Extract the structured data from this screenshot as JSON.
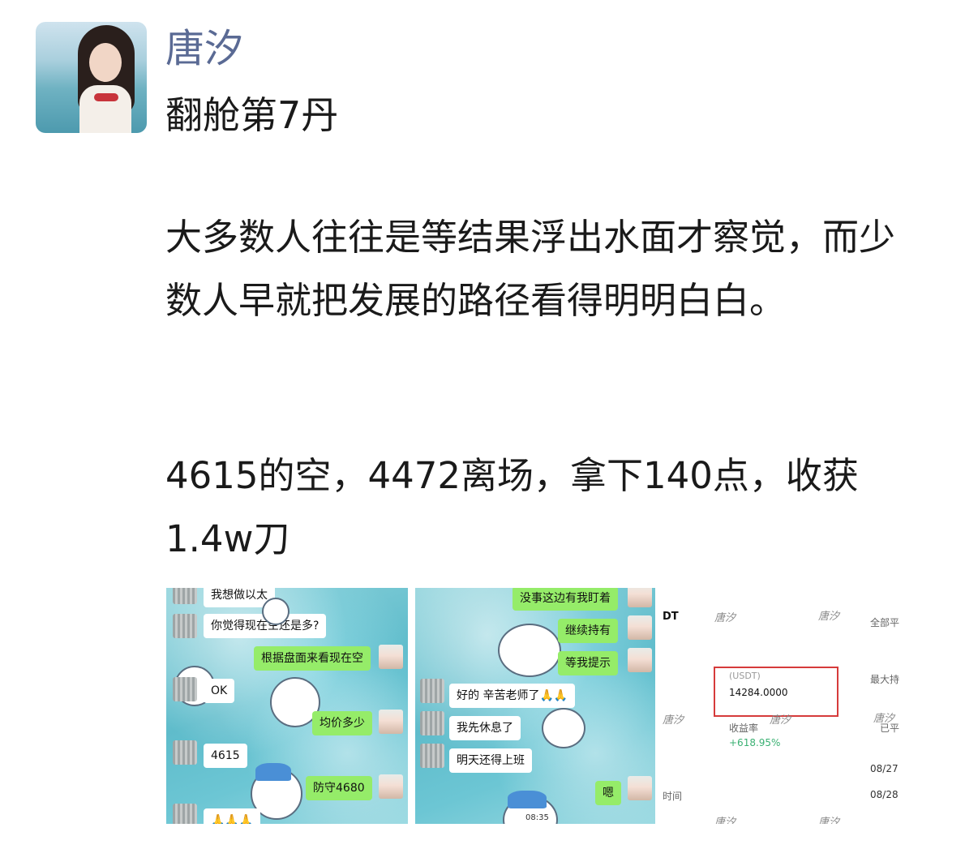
{
  "post": {
    "author": "唐汐",
    "title": "翻舱第7丹",
    "paragraph1": "大多数人往往是等结果浮出水面才察觉，而少数人早就把发展的路径看得明明白白。",
    "paragraph2": "4615的空，4472离场，拿下140点，收获1.4w刀"
  },
  "chat1": {
    "messages": [
      {
        "side": "left",
        "text": "我想做以太"
      },
      {
        "side": "left",
        "text": "你觉得现在空还是多?"
      },
      {
        "side": "right",
        "text": "根据盘面来看现在空"
      },
      {
        "side": "left",
        "text": "OK"
      },
      {
        "side": "right",
        "text": "均价多少"
      },
      {
        "side": "left",
        "text": "4615"
      },
      {
        "side": "right",
        "text": "防守4680"
      },
      {
        "side": "left",
        "text": "🙏🙏🙏"
      }
    ]
  },
  "chat2": {
    "messages": [
      {
        "side": "right",
        "text": "没事这边有我盯着"
      },
      {
        "side": "right",
        "text": "继续持有"
      },
      {
        "side": "right",
        "text": "等我提示"
      },
      {
        "side": "left",
        "text": "好的 辛苦老师了🙏🙏"
      },
      {
        "side": "left",
        "text": "我先休息了"
      },
      {
        "side": "left",
        "text": "明天还得上班"
      },
      {
        "side": "right",
        "text": "嗯"
      }
    ],
    "timestamp": "08:35"
  },
  "account": {
    "partial_header": "DT",
    "right_labels": [
      "全部平",
      "最大持",
      "已平",
      "08/27",
      "08/28"
    ],
    "amount_label": "(USDT)",
    "amount": "14284.0000",
    "yield_label": "收益率",
    "yield_value": "+618.95%",
    "time_label": "时间",
    "watermark": "唐汐"
  },
  "colors": {
    "author_name": "#5a6a94",
    "text": "#1a1a1a",
    "wechat_green": "#95ec69",
    "profit_green": "#3bb173",
    "highlight_red": "#d63b3b"
  }
}
